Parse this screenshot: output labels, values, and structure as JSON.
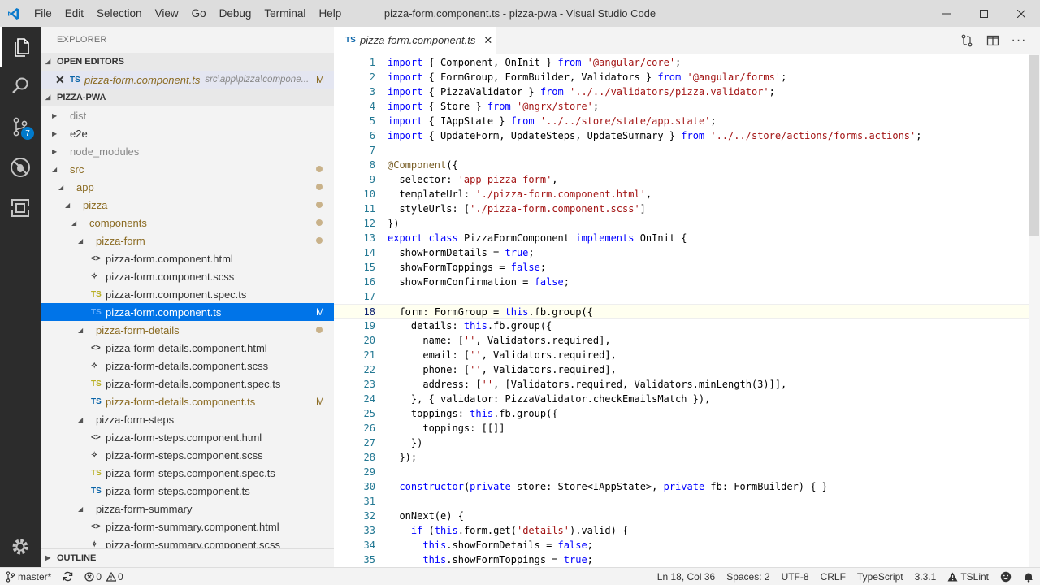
{
  "window": {
    "title": "pizza-form.component.ts - pizza-pwa - Visual Studio Code",
    "menu": [
      "File",
      "Edit",
      "Selection",
      "View",
      "Go",
      "Debug",
      "Terminal",
      "Help"
    ]
  },
  "activity": {
    "scm_badge": "7"
  },
  "sidebar": {
    "title": "EXPLORER",
    "open_editors": {
      "heading": "OPEN EDITORS",
      "items": [
        {
          "icon": "TS",
          "name": "pizza-form.component.ts",
          "path": "src\\app\\pizza\\compone...",
          "status": "M"
        }
      ]
    },
    "project": {
      "heading": "PIZZA-PWA"
    },
    "tree": [
      {
        "label": "dist",
        "kind": "folder",
        "open": false,
        "indent": 0,
        "dim": true
      },
      {
        "label": "e2e",
        "kind": "folder",
        "open": false,
        "indent": 0
      },
      {
        "label": "node_modules",
        "kind": "folder",
        "open": false,
        "indent": 0,
        "dim": true
      },
      {
        "label": "src",
        "kind": "folder",
        "open": true,
        "indent": 0,
        "modified": true,
        "dot": true
      },
      {
        "label": "app",
        "kind": "folder",
        "open": true,
        "indent": 1,
        "modified": true,
        "dot": true
      },
      {
        "label": "pizza",
        "kind": "folder",
        "open": true,
        "indent": 2,
        "modified": true,
        "dot": true
      },
      {
        "label": "components",
        "kind": "folder",
        "open": true,
        "indent": 3,
        "modified": true,
        "dot": true
      },
      {
        "label": "pizza-form",
        "kind": "folder",
        "open": true,
        "indent": 4,
        "modified": true,
        "dot": true
      },
      {
        "label": "pizza-form.component.html",
        "kind": "html",
        "icon": "<>",
        "indent": 5
      },
      {
        "label": "pizza-form.component.scss",
        "kind": "scss",
        "icon": "✧",
        "indent": 5
      },
      {
        "label": "pizza-form.component.spec.ts",
        "kind": "ts",
        "icon": "TS",
        "indent": 5
      },
      {
        "label": "pizza-form.component.ts",
        "kind": "tsb",
        "icon": "TS",
        "indent": 5,
        "selected": true,
        "status": "M"
      },
      {
        "label": "pizza-form-details",
        "kind": "folder",
        "open": true,
        "indent": 4,
        "modified": true,
        "dot": true
      },
      {
        "label": "pizza-form-details.component.html",
        "kind": "html",
        "icon": "<>",
        "indent": 5
      },
      {
        "label": "pizza-form-details.component.scss",
        "kind": "scss",
        "icon": "✧",
        "indent": 5
      },
      {
        "label": "pizza-form-details.component.spec.ts",
        "kind": "ts",
        "icon": "TS",
        "indent": 5
      },
      {
        "label": "pizza-form-details.component.ts",
        "kind": "tsb",
        "icon": "TS",
        "indent": 5,
        "modified": true,
        "status": "M"
      },
      {
        "label": "pizza-form-steps",
        "kind": "folder",
        "open": true,
        "indent": 4
      },
      {
        "label": "pizza-form-steps.component.html",
        "kind": "html",
        "icon": "<>",
        "indent": 5
      },
      {
        "label": "pizza-form-steps.component.scss",
        "kind": "scss",
        "icon": "✧",
        "indent": 5
      },
      {
        "label": "pizza-form-steps.component.spec.ts",
        "kind": "ts",
        "icon": "TS",
        "indent": 5
      },
      {
        "label": "pizza-form-steps.component.ts",
        "kind": "tsb",
        "icon": "TS",
        "indent": 5
      },
      {
        "label": "pizza-form-summary",
        "kind": "folder",
        "open": true,
        "indent": 4
      },
      {
        "label": "pizza-form-summary.component.html",
        "kind": "html",
        "icon": "<>",
        "indent": 5
      },
      {
        "label": "pizza-form-summary.component.scss",
        "kind": "scss",
        "icon": "✧",
        "indent": 5
      }
    ],
    "outline_heading": "OUTLINE"
  },
  "editor": {
    "tab": {
      "icon": "TS",
      "label": "pizza-form.component.ts"
    },
    "current_line": 18,
    "lines": [
      "import { Component, OnInit } from '@angular/core';",
      "import { FormGroup, FormBuilder, Validators } from '@angular/forms';",
      "import { PizzaValidator } from '../../validators/pizza.validator';",
      "import { Store } from '@ngrx/store';",
      "import { IAppState } from '../../store/state/app.state';",
      "import { UpdateForm, UpdateSteps, UpdateSummary } from '../../store/actions/forms.actions';",
      "",
      "@Component({",
      "  selector: 'app-pizza-form',",
      "  templateUrl: './pizza-form.component.html',",
      "  styleUrls: ['./pizza-form.component.scss']",
      "})",
      "export class PizzaFormComponent implements OnInit {",
      "  showFormDetails = true;",
      "  showFormToppings = false;",
      "  showFormConfirmation = false;",
      "",
      "  form: FormGroup = this.fb.group({",
      "    details: this.fb.group({",
      "      name: ['', Validators.required],",
      "      email: ['', Validators.required],",
      "      phone: ['', Validators.required],",
      "      address: ['', [Validators.required, Validators.minLength(3)]],",
      "    }, { validator: PizzaValidator.checkEmailsMatch }),",
      "    toppings: this.fb.group({",
      "      toppings: [[]]",
      "    })",
      "  });",
      "",
      "  constructor(private store: Store<IAppState>, private fb: FormBuilder) { }",
      "",
      "  onNext(e) {",
      "    if (this.form.get('details').valid) {",
      "      this.showFormDetails = false;",
      "      this.showFormToppings = true;"
    ]
  },
  "status": {
    "branch": "master*",
    "errors": "0",
    "warnings": "0",
    "position": "Ln 18, Col 36",
    "spaces": "Spaces: 2",
    "encoding": "UTF-8",
    "eol": "CRLF",
    "language": "TypeScript",
    "version": "3.3.1",
    "linter": "TSLint"
  }
}
